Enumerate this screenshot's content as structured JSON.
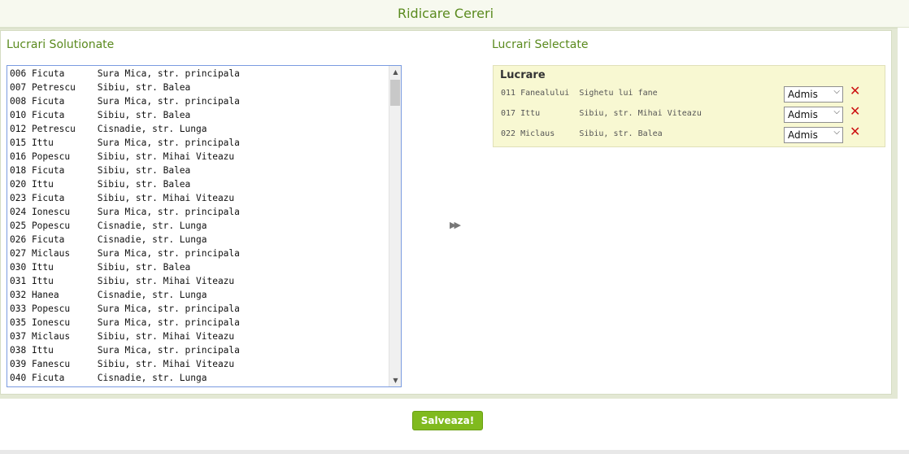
{
  "header": {
    "title": "Ridicare Cereri"
  },
  "left": {
    "title": "Lucrari Solutionate",
    "items": [
      "006 Ficuta      Sura Mica, str. principala",
      "007 Petrescu    Sibiu, str. Balea",
      "008 Ficuta      Sura Mica, str. principala",
      "010 Ficuta      Sibiu, str. Balea",
      "012 Petrescu    Cisnadie, str. Lunga",
      "015 Ittu        Sura Mica, str. principala",
      "016 Popescu     Sibiu, str. Mihai Viteazu",
      "018 Ficuta      Sibiu, str. Balea",
      "020 Ittu        Sibiu, str. Balea",
      "023 Ficuta      Sibiu, str. Mihai Viteazu",
      "024 Ionescu     Sura Mica, str. principala",
      "025 Popescu     Cisnadie, str. Lunga",
      "026 Ficuta      Cisnadie, str. Lunga",
      "027 Miclaus     Sura Mica, str. principala",
      "030 Ittu        Sibiu, str. Balea",
      "031 Ittu        Sibiu, str. Mihai Viteazu",
      "032 Hanea       Cisnadie, str. Lunga",
      "033 Popescu     Sura Mica, str. principala",
      "035 Ionescu     Sura Mica, str. principala",
      "037 Miclaus     Sibiu, str. Mihai Viteazu",
      "038 Ittu        Sura Mica, str. principala",
      "039 Fanescu     Sibiu, str. Mihai Viteazu",
      "040 Ficuta      Cisnadie, str. Lunga"
    ]
  },
  "right": {
    "title": "Lucrari Selectate",
    "header": "Lucrare",
    "rows": [
      {
        "text": "011 Fanealului  Sighetu lui fane",
        "status": "Admis"
      },
      {
        "text": "017 Ittu        Sibiu, str. Mihai Viteazu",
        "status": "Admis"
      },
      {
        "text": "022 Miclaus     Sibiu, str. Balea",
        "status": "Admis"
      }
    ]
  },
  "icons": {
    "move": "double-chevron-right-icon",
    "delete": "close-x-icon",
    "dropdown": "chevron-down-icon"
  },
  "save_label": "Salveaza!",
  "colors": {
    "accent": "#5a8a1e",
    "button": "#80ba1e",
    "delete": "#cc1111",
    "selected_bg": "#f8f8d2"
  }
}
